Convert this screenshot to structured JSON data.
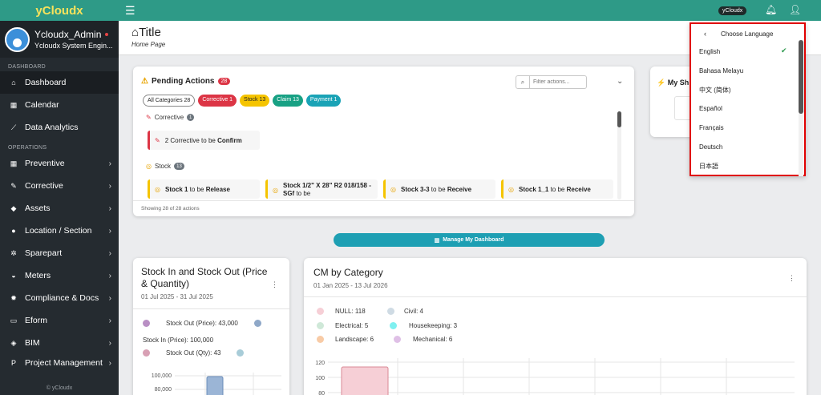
{
  "app": {
    "brand": "yCloudx",
    "copyright": "© yCloudx"
  },
  "user": {
    "name": "Ycloudx_Admin",
    "role": "Ycloudx System Engin..."
  },
  "sidebar": {
    "section_dashboard": "DASHBOARD",
    "section_operations": "OPERATIONS",
    "items": [
      {
        "label": "Dashboard",
        "icon": "home-icon"
      },
      {
        "label": "Calendar",
        "icon": "calendar-icon"
      },
      {
        "label": "Data Analytics",
        "icon": "chart-line-icon"
      },
      {
        "label": "Preventive",
        "icon": "calendar-grid-icon"
      },
      {
        "label": "Corrective",
        "icon": "wrench-icon"
      },
      {
        "label": "Assets",
        "icon": "tag-icon"
      },
      {
        "label": "Location / Section",
        "icon": "globe-icon"
      },
      {
        "label": "Sparepart",
        "icon": "cogs-icon"
      },
      {
        "label": "Meters",
        "icon": "gauge-icon"
      },
      {
        "label": "Compliance & Docs",
        "icon": "certificate-icon"
      },
      {
        "label": "Eform",
        "icon": "file-icon"
      },
      {
        "label": "BIM",
        "icon": "cube-icon"
      },
      {
        "label": "Project Management",
        "icon": "project-icon"
      }
    ]
  },
  "topbar": {
    "org_pill": "yCloudx"
  },
  "page": {
    "title": "Title",
    "subtitle": "Home Page"
  },
  "pending": {
    "title": "Pending Actions",
    "count": "28",
    "filter_placeholder": "Filter actions...",
    "chips": [
      "All Categories 28",
      "Corrective 1",
      "Stock 13",
      "Claim 13",
      "Payment 1"
    ],
    "corrective_label": "Corrective",
    "corrective_count": "1",
    "corrective_item": {
      "num": "2",
      "mid": " Corrective to be ",
      "bold": "Confirm"
    },
    "stock_label": "Stock",
    "stock_count": "13",
    "stock_items": [
      {
        "name": "Stock 1",
        "mid": " to be ",
        "bold": "Release"
      },
      {
        "name": "Stock 1/2\" X 28\" R2 018/158 - SGf",
        "mid": " to be",
        "bold": ""
      },
      {
        "name": "Stock 3-3",
        "mid": " to be ",
        "bold": "Receive"
      },
      {
        "name": "Stock 1_1",
        "mid": " to be ",
        "bold": "Receive"
      }
    ],
    "footer": "Showing 28 of 28 actions"
  },
  "shortcuts": {
    "title": "My Sh"
  },
  "manage_button": "Manage My Dashboard",
  "stock_card": {
    "title": "Stock In and Stock Out (Price & Quantity)",
    "date": "01 Jul 2025 - 31 Jul 2025",
    "legend": [
      {
        "label": "Stock Out (Price): 43,000",
        "color": "#b98fc4"
      },
      {
        "label": "Stock In (Price): 100,000",
        "color": "#8fa8c8"
      },
      {
        "label": "Stock Out (Qty): 43",
        "color": "#d8a0b4"
      },
      {
        "label": "",
        "color": "#a8ccd8"
      }
    ],
    "y_ticks": [
      "100,000",
      "80,000"
    ]
  },
  "cm_card": {
    "title": "CM by Category",
    "date": "01 Jan 2025 - 13 Jul 2026",
    "legend": [
      {
        "label": "NULL: 118",
        "color": "#f6cfd6"
      },
      {
        "label": "Civil: 4",
        "color": "#cfdbe4"
      },
      {
        "label": "Electrical: 5",
        "color": "#cfe8d8"
      },
      {
        "label": "Housekeeping: 3",
        "color": "#7ff0f0"
      },
      {
        "label": "Landscape: 6",
        "color": "#f8cba6"
      },
      {
        "label": "Mechanical: 6",
        "color": "#dfc0e6"
      }
    ],
    "y_ticks": [
      "120",
      "100",
      "80"
    ]
  },
  "language": {
    "header": "Choose Language",
    "options": [
      "English",
      "Bahasa Melayu",
      "中文 (简体)",
      "Español",
      "Français",
      "Deutsch",
      "日本語"
    ],
    "selected": "English"
  },
  "colors": {
    "accent": "#2e9a87",
    "sidebar": "#252b30",
    "danger": "#dc3545",
    "warning": "#f5c400",
    "info": "#1e9fb3"
  }
}
